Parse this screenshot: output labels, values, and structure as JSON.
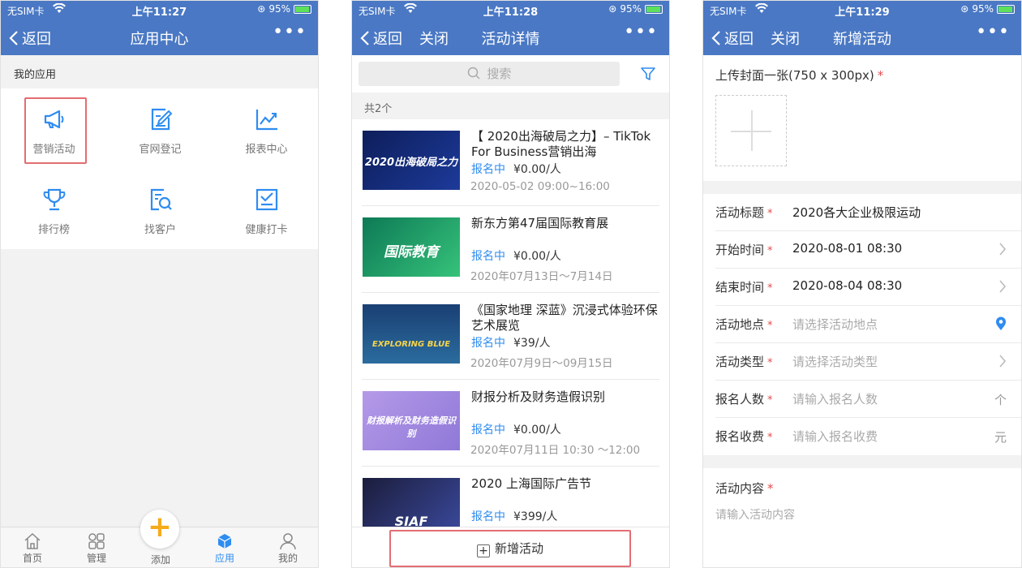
{
  "status": {
    "carrier": "无SIM卡",
    "battery": "95%",
    "time_1": "上午11:27",
    "time_2": "上午11:28",
    "time_3": "上午11:29"
  },
  "screen1": {
    "back_label": "返回",
    "title": "应用中心",
    "more": "•••",
    "section_label": "我的应用",
    "apps": [
      {
        "label": "营销活动",
        "icon": "megaphone-icon"
      },
      {
        "label": "官网登记",
        "icon": "edit-doc-icon"
      },
      {
        "label": "报表中心",
        "icon": "chart-line-icon"
      },
      {
        "label": "排行榜",
        "icon": "trophy-icon"
      },
      {
        "label": "找客户",
        "icon": "doc-search-icon"
      },
      {
        "label": "健康打卡",
        "icon": "checkin-icon"
      }
    ],
    "tabs": [
      {
        "label": "首页",
        "icon": "home-icon"
      },
      {
        "label": "管理",
        "icon": "grid-icon"
      },
      {
        "label": "添加",
        "icon": "plus-icon"
      },
      {
        "label": "应用",
        "icon": "cube-icon"
      },
      {
        "label": "我的",
        "icon": "user-icon"
      }
    ],
    "fab": "+"
  },
  "screen2": {
    "back_label": "返回",
    "close_label": "关闭",
    "title": "活动详情",
    "more": "•••",
    "search_placeholder": "搜索",
    "count": "共2个",
    "items": [
      {
        "title": "【 2020出海破局之力】– TikTok For Business营销出海",
        "status": "报名中",
        "price": "¥0.00/人",
        "date": "2020-05-02 09:00~16:00",
        "thumb": "2020出海破局之力"
      },
      {
        "title": "新东方第47届国际教育展",
        "status": "报名中",
        "price": "¥0.00/人",
        "date": "2020年07月13日～7月14日",
        "thumb": "国际教育"
      },
      {
        "title": "《国家地理 深蓝》沉浸式体验环保艺术展览",
        "status": "报名中",
        "price": "¥39/人",
        "date": "2020年07月9日～09月15日",
        "thumb": "EXPLORING BLUE"
      },
      {
        "title": "财报分析及财务造假识别",
        "status": "报名中",
        "price": "¥0.00/人",
        "date": "2020年07月11日 10:30 ～12:00",
        "thumb": "财报解析及财务造假识别"
      },
      {
        "title": "2020 上海国际广告节",
        "status": "报名中",
        "price": "¥399/人",
        "date": "",
        "thumb": "SIAF"
      }
    ],
    "add_button": "新增活动"
  },
  "screen3": {
    "back_label": "返回",
    "close_label": "关闭",
    "title": "新增活动",
    "more": "•••",
    "upload_label": "上传封面一张(750 x 300px)",
    "required_mark": "*",
    "fields": [
      {
        "label": "活动标题",
        "value": "2020各大企业极限运动",
        "placeholder": false,
        "accessory": ""
      },
      {
        "label": "开始时间",
        "value": "2020-08-01 08:30",
        "placeholder": false,
        "accessory": "chevron"
      },
      {
        "label": "结束时间",
        "value": "2020-08-04 08:30",
        "placeholder": false,
        "accessory": "chevron"
      },
      {
        "label": "活动地点",
        "value": "请选择活动地点",
        "placeholder": true,
        "accessory": "location"
      },
      {
        "label": "活动类型",
        "value": "请选择活动类型",
        "placeholder": true,
        "accessory": "chevron"
      },
      {
        "label": "报名人数",
        "value": "请输入报名人数",
        "placeholder": true,
        "accessory": "个"
      },
      {
        "label": "报名收费",
        "value": "请输入报名收费",
        "placeholder": true,
        "accessory": "元"
      }
    ],
    "content_label": "活动内容",
    "content_placeholder": "请输入活动内容"
  },
  "colors": {
    "nav_blue": "#4a78c4",
    "accent_blue": "#2f8cf0",
    "highlight_red": "#e36d72",
    "fab_orange": "#f6ab1b"
  }
}
